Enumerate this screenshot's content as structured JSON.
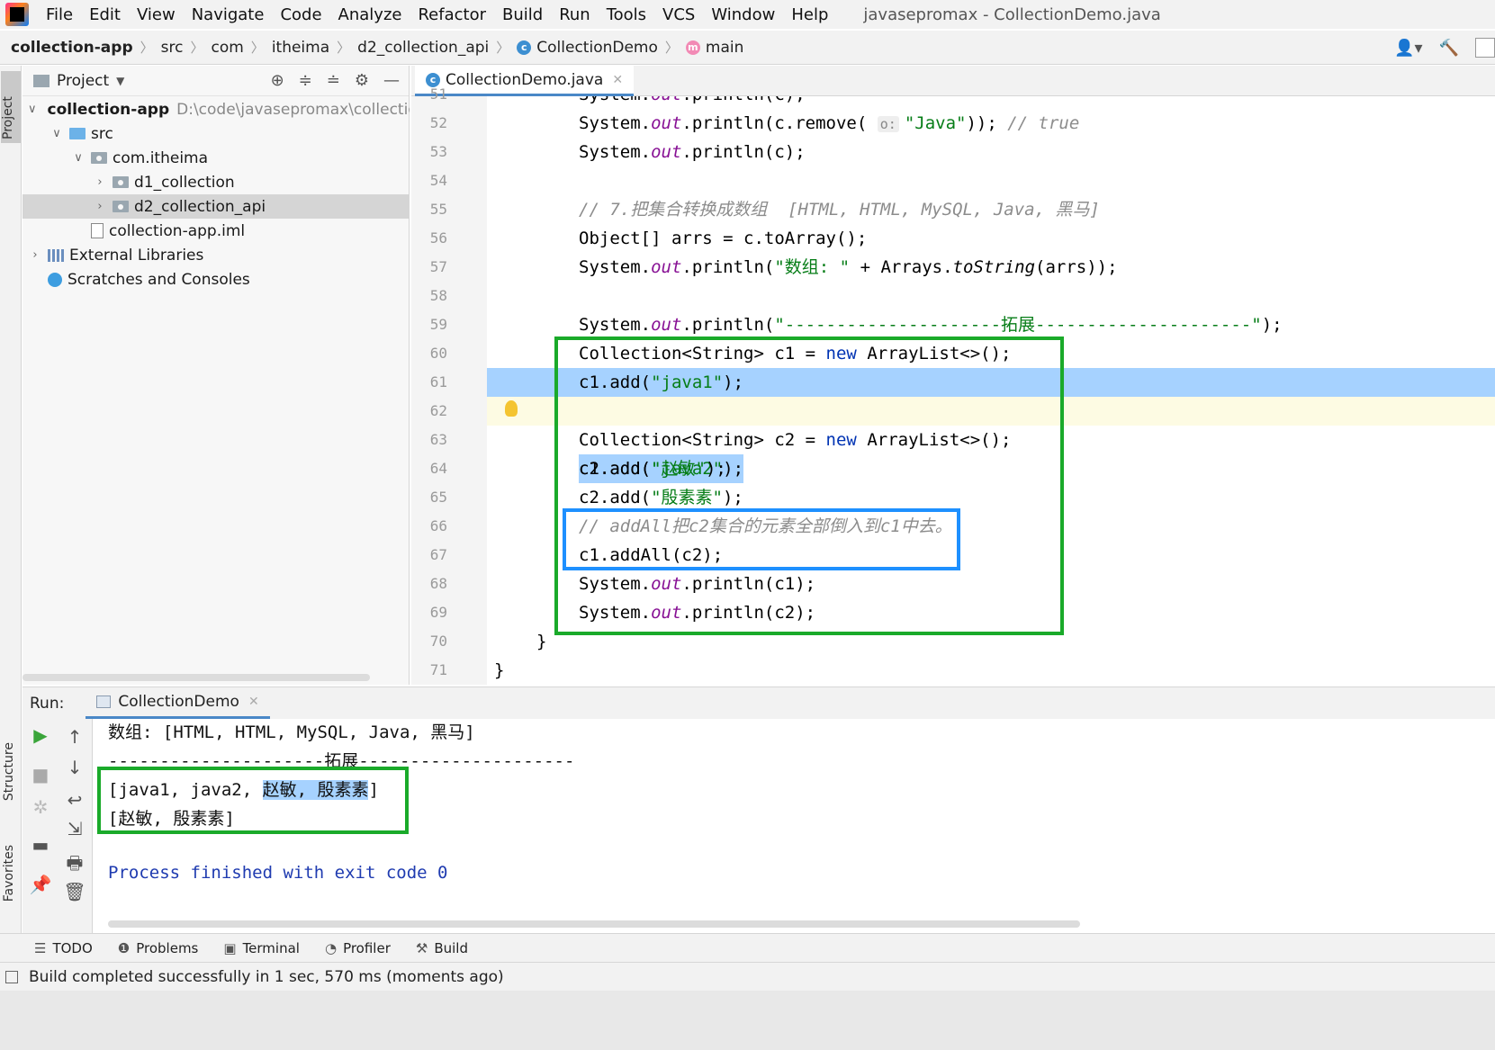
{
  "menubar": {
    "items": [
      "File",
      "Edit",
      "View",
      "Navigate",
      "Code",
      "Analyze",
      "Refactor",
      "Build",
      "Run",
      "Tools",
      "VCS",
      "Window",
      "Help"
    ],
    "window_title": "javasepromax - CollectionDemo.java"
  },
  "navbar": {
    "crumbs": [
      "collection-app",
      "src",
      "com",
      "itheima",
      "d2_collection_api",
      "CollectionDemo",
      "main"
    ]
  },
  "leftstripe": {
    "project": "Project",
    "structure": "Structure",
    "favorites": "Favorites"
  },
  "project_panel": {
    "title": "Project",
    "tree": [
      {
        "label": "collection-app",
        "path": "D:\\code\\javasepromax\\collectio",
        "expanded": true
      },
      {
        "label": "src",
        "expanded": true
      },
      {
        "label": "com.itheima",
        "expanded": true
      },
      {
        "label": "d1_collection",
        "expanded": false
      },
      {
        "label": "d2_collection_api",
        "expanded": false,
        "selected": true
      },
      {
        "label": "collection-app.iml"
      },
      {
        "label": "External Libraries",
        "expanded": false
      },
      {
        "label": "Scratches and Consoles"
      }
    ]
  },
  "editor": {
    "tab": "CollectionDemo.java",
    "lines": [
      {
        "n": "51",
        "text": "System.out.println(c);"
      },
      {
        "n": "52",
        "text": "System.out.println(c.remove( o: \"Java\")); // true"
      },
      {
        "n": "53",
        "text": "System.out.println(c);"
      },
      {
        "n": "54",
        "text": ""
      },
      {
        "n": "55",
        "text": "// 7.把集合转换成数组  [HTML, HTML, MySQL, Java, 黑马]"
      },
      {
        "n": "56",
        "text": "Object[] arrs = c.toArray();"
      },
      {
        "n": "57",
        "text": "System.out.println(\"数组: \" + Arrays.toString(arrs));"
      },
      {
        "n": "58",
        "text": ""
      },
      {
        "n": "59",
        "text": "System.out.println(\"---------------------拓展---------------------\");"
      },
      {
        "n": "60",
        "text": "Collection<String> c1 = new ArrayList<>();"
      },
      {
        "n": "61",
        "text": "c1.add(\"java1\");"
      },
      {
        "n": "62",
        "text": "c1.add(\"java2\");"
      },
      {
        "n": "63",
        "text": "Collection<String> c2 = new ArrayList<>();"
      },
      {
        "n": "64",
        "text": "c2.add(\"赵敏\");"
      },
      {
        "n": "65",
        "text": "c2.add(\"殷素素\");"
      },
      {
        "n": "66",
        "text": "// addAll把c2集合的元素全部倒入到c1中去。"
      },
      {
        "n": "67",
        "text": "c1.addAll(c2);"
      },
      {
        "n": "68",
        "text": "System.out.println(c1);"
      },
      {
        "n": "69",
        "text": "System.out.println(c2);"
      },
      {
        "n": "70",
        "text": "}"
      },
      {
        "n": "71",
        "text": "}"
      }
    ],
    "tokens": {
      "system": "System.",
      "out": "out",
      "println": ".println(",
      "l52_a": "c.remove( ",
      "l52_hint": "o:",
      "l52_str": "\"Java\"",
      "l52_b": ")); ",
      "l52_cm": "// true",
      "l53_b": "c);",
      "l55_cm": "// 7.把集合转换成数组  [HTML, HTML, MySQL, Java, 黑马]",
      "l56": "Object[] arrs = c.toArray();",
      "l57_str": "\"数组: \"",
      "l57_a": " + Arrays.",
      "l57_m": "toString",
      "l57_b": "(arrs));",
      "l59_str": "\"---------------------拓展---------------------\"",
      "l59_b": ");",
      "l60_a": "Collection<String> c1 = ",
      "new": "new",
      "l60_b": " ArrayList<>();",
      "l61_a": "c1.add(",
      "l61_str": "\"java1\"",
      "l61_b": ");",
      "l62_a": "c1.add(",
      "l62_str": "\"java2\"",
      "l62_b": ");",
      "l63_a": "Collection<String> c2 = ",
      "l63_b": " ArrayList<>();",
      "l64_a": "c2.add(",
      "l64_str": "\"赵敏\"",
      "l64_b": ");",
      "l65_a": "c2.add(",
      "l65_str": "\"殷素素\"",
      "l65_b": ");",
      "l66_cm": "// addAll把c2集合的元素全部倒入到c1中去。",
      "l67": "c1.addAll(c2);",
      "l68_b": "c1);",
      "l69_b": "c2);",
      "brace": "}"
    }
  },
  "run": {
    "label": "Run:",
    "tab": "CollectionDemo",
    "output": [
      "数组: [HTML, HTML, MySQL, Java, 黑马]",
      "---------------------拓展---------------------",
      "[java1, java2, ",
      "赵敏, 殷素素",
      "]",
      "[赵敏, 殷素素]",
      "Process finished with exit code 0"
    ]
  },
  "bottom_tools": [
    "TODO",
    "Problems",
    "Terminal",
    "Profiler",
    "Build"
  ],
  "status": "Build completed successfully in 1 sec, 570 ms (moments ago)",
  "colors": {
    "highlight_green": "#1aaa2a",
    "highlight_blue": "#1e90ff",
    "selection": "#a6d2ff"
  }
}
